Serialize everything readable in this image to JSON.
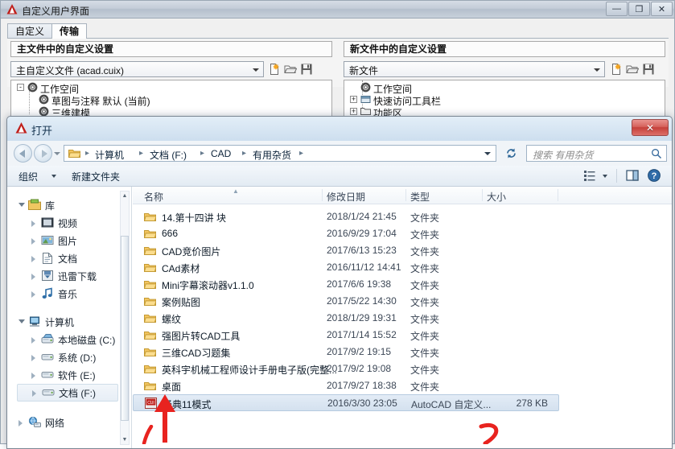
{
  "cui_window": {
    "title": "自定义用户界面",
    "logo_icon": "autocad-triangle-icon",
    "window_buttons": [
      {
        "name": "minimize",
        "glyph": "—"
      },
      {
        "name": "maximize",
        "glyph": "❐"
      },
      {
        "name": "close",
        "glyph": "✕"
      }
    ],
    "tabs": [
      {
        "label": "自定义",
        "active": false
      },
      {
        "label": "传输",
        "active": true
      }
    ],
    "left_panel": {
      "header": "主文件中的自定义设置",
      "combo_value": "主自定义文件 (acad.cuix)",
      "toolbar_icons": [
        "new-file-icon",
        "open-folder-icon",
        "save-disk-icon"
      ],
      "tree": [
        {
          "label": "工作空间",
          "icon": "gear-icon",
          "expander": "-",
          "depth": 0
        },
        {
          "label": "草图与注释 默认 (当前)",
          "icon": "gear-icon",
          "expander": "",
          "depth": 1
        },
        {
          "label": "三维建模",
          "icon": "gear-icon",
          "expander": "",
          "depth": 1
        }
      ]
    },
    "right_panel": {
      "header": "新文件中的自定义设置",
      "combo_value": "新文件",
      "toolbar_icons": [
        "new-file-icon",
        "open-folder-icon",
        "save-disk-icon"
      ],
      "tree": [
        {
          "label": "工作空间",
          "icon": "gear-icon",
          "expander": "",
          "depth": 0
        },
        {
          "label": "快速访问工具栏",
          "icon": "toolbar-icon",
          "expander": "+",
          "depth": 0
        },
        {
          "label": "功能区",
          "icon": "folder-icon",
          "expander": "+",
          "depth": 0
        }
      ]
    }
  },
  "open_dialog": {
    "title": "打开",
    "logo_icon": "autocad-triangle-icon",
    "close_label": "✕",
    "nav": {
      "back_icon": "back-arrow-icon",
      "forward_icon": "forward-arrow-icon",
      "recent_icon": "chevron-down-icon",
      "folder_icon": "folder-icon",
      "breadcrumb": [
        "计算机",
        "文档 (F:)",
        "CAD",
        "有用杂货"
      ],
      "breadcrumb_separator": "▸",
      "dropdown_icon": "chevron-down-icon",
      "refresh_icon": "refresh-icon",
      "search_placeholder": "搜索 有用杂货",
      "search_icon": "search-icon"
    },
    "command_bar": {
      "organize_label": "组织",
      "organize_caret_icon": "chevron-down-icon",
      "new_folder_label": "新建文件夹",
      "view_icon": "view-list-icon",
      "view_caret_icon": "chevron-down-icon",
      "preview_pane_icon": "preview-pane-icon",
      "help_icon": "help-icon"
    },
    "sidebar": [
      {
        "label": "库",
        "icon": "library-icon",
        "depth": 0,
        "expanded": true,
        "selected": false
      },
      {
        "label": "视频",
        "icon": "video-icon",
        "depth": 1,
        "expanded": false,
        "selected": false
      },
      {
        "label": "图片",
        "icon": "pictures-icon",
        "depth": 1,
        "expanded": false,
        "selected": false
      },
      {
        "label": "文档",
        "icon": "documents-icon",
        "depth": 1,
        "expanded": false,
        "selected": false
      },
      {
        "label": "迅雷下载",
        "icon": "downloads-icon",
        "depth": 1,
        "expanded": false,
        "selected": false
      },
      {
        "label": "音乐",
        "icon": "music-icon",
        "depth": 1,
        "expanded": false,
        "selected": false
      },
      {
        "label": "计算机",
        "icon": "computer-icon",
        "depth": 0,
        "expanded": true,
        "selected": false
      },
      {
        "label": "本地磁盘 (C:)",
        "icon": "system-drive-icon",
        "depth": 1,
        "expanded": false,
        "selected": false
      },
      {
        "label": "系统 (D:)",
        "icon": "drive-icon",
        "depth": 1,
        "expanded": false,
        "selected": false
      },
      {
        "label": "软件 (E:)",
        "icon": "drive-icon",
        "depth": 1,
        "expanded": false,
        "selected": false
      },
      {
        "label": "文档 (F:)",
        "icon": "drive-icon",
        "depth": 1,
        "expanded": false,
        "selected": true
      },
      {
        "label": "网络",
        "icon": "network-icon",
        "depth": 0,
        "expanded": false,
        "selected": false
      }
    ],
    "columns": [
      "名称",
      "修改日期",
      "类型",
      "大小"
    ],
    "sort_column": "名称",
    "sort_indicator": "▲",
    "files": [
      {
        "name": "14.第十四讲 块",
        "date": "2018/1/24 21:45",
        "type": "文件夹",
        "size": "",
        "icon": "folder-icon",
        "selected": false
      },
      {
        "name": "666",
        "date": "2016/9/29 17:04",
        "type": "文件夹",
        "size": "",
        "icon": "folder-icon",
        "selected": false
      },
      {
        "name": "CAD竞价图片",
        "date": "2017/6/13 15:23",
        "type": "文件夹",
        "size": "",
        "icon": "folder-icon",
        "selected": false
      },
      {
        "name": "CAd素材",
        "date": "2016/11/12 14:41",
        "type": "文件夹",
        "size": "",
        "icon": "folder-icon",
        "selected": false
      },
      {
        "name": "Mini字幕滚动器v1.1.0",
        "date": "2017/6/6 19:38",
        "type": "文件夹",
        "size": "",
        "icon": "folder-icon",
        "selected": false
      },
      {
        "name": "案例贴图",
        "date": "2017/5/22 14:30",
        "type": "文件夹",
        "size": "",
        "icon": "folder-icon",
        "selected": false
      },
      {
        "name": "螺纹",
        "date": "2018/1/29 19:31",
        "type": "文件夹",
        "size": "",
        "icon": "folder-icon",
        "selected": false
      },
      {
        "name": "强图片转CAD工具",
        "date": "2017/1/14 15:52",
        "type": "文件夹",
        "size": "",
        "icon": "folder-icon",
        "selected": false
      },
      {
        "name": "三维CAD习题集",
        "date": "2017/9/2 19:15",
        "type": "文件夹",
        "size": "",
        "icon": "folder-icon",
        "selected": false
      },
      {
        "name": "英科宇机械工程师设计手册电子版(完整...",
        "date": "2017/9/2 19:08",
        "type": "文件夹",
        "size": "",
        "icon": "folder-icon",
        "selected": false
      },
      {
        "name": "桌面",
        "date": "2017/9/27 18:38",
        "type": "文件夹",
        "size": "",
        "icon": "folder-icon",
        "selected": false
      },
      {
        "name": "经典11模式",
        "date": "2016/3/30 23:05",
        "type": "AutoCAD 自定义...",
        "size": "278 KB",
        "icon": "cui-file-icon",
        "selected": true
      }
    ]
  },
  "annotations": {
    "arrow_color": "#e8231f",
    "marks": [
      "up-arrow-pointing-at-selected-file",
      "red-stroke-left",
      "red-curve-bottom"
    ]
  }
}
